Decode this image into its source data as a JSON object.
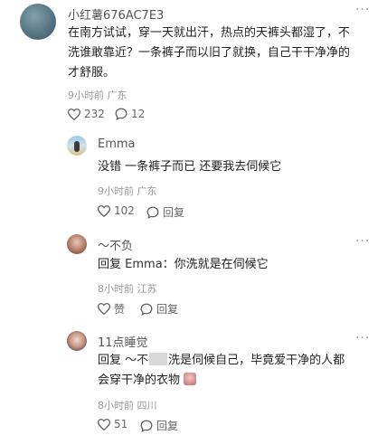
{
  "comment": {
    "username": "小红薯676AC7E3",
    "text_line1": "在南方试试，穿一天就出汗，热点的天裤头都湿了，不",
    "text_line2": "洗谁敢靠近？一条裤子而以旧了就换，自己干干净净的",
    "text_line3": "才舒服。",
    "time": "9小时前",
    "location": "广东",
    "likes": "232",
    "replies": "12"
  },
  "replies": [
    {
      "username": "Emma",
      "text": "没错 一条裤子而已 还要我去伺候它",
      "time": "9小时前",
      "location": "广东",
      "likes": "102",
      "reply_label": "回复"
    },
    {
      "username": "～不负",
      "reply_prefix": "回复",
      "reply_to": "Emma",
      "text": "：你洗就是在伺候它",
      "time": "8小时前",
      "location": "江苏",
      "likes": "赞",
      "reply_label": "回复"
    },
    {
      "username": "11点睡觉",
      "reply_prefix": "回复",
      "reply_to": "～不",
      "text_line1_rest": "洗是伺候自己，毕竟爱干净的人都",
      "text_line2": "会穿干净的衣物",
      "time": "8小时前",
      "location": "四川",
      "likes": "51",
      "reply_label": "回复"
    }
  ],
  "icons": [
    "more-icon",
    "heart-icon",
    "comment-icon"
  ],
  "colors": {
    "text": "#222222",
    "meta": "#999999",
    "avatar_main": "#5d7d8c"
  }
}
